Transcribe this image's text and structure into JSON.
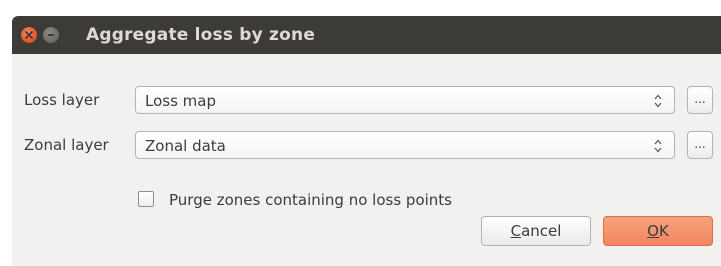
{
  "window": {
    "title": "Aggregate loss by zone"
  },
  "form": {
    "loss_layer": {
      "label": "Loss layer",
      "value": "Loss map",
      "browse_label": "..."
    },
    "zonal_layer": {
      "label": "Zonal layer",
      "value": "Zonal data",
      "browse_label": "..."
    },
    "purge_zones": {
      "label": "Purge zones containing no loss points",
      "checked": false
    }
  },
  "buttons": {
    "cancel": {
      "mnemonic": "C",
      "rest": "ancel"
    },
    "ok": {
      "mnemonic": "O",
      "rest": "K"
    }
  },
  "colors": {
    "titlebar": "#3c3b37",
    "title_text": "#dfdbd2",
    "window_bg": "#f2f1f0",
    "close_button": "#e5582b",
    "ok_button": "#f08760"
  }
}
